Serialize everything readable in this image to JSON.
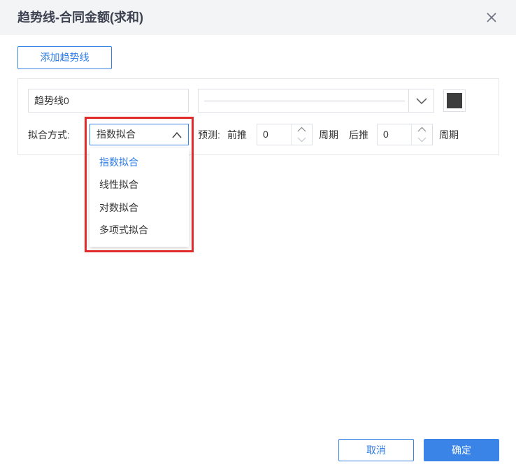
{
  "dialog": {
    "title": "趋势线-合同金额(求和)",
    "close_icon": "close-icon"
  },
  "toolbar": {
    "add_trendline_label": "添加趋势线"
  },
  "trendline": {
    "name_value": "趋势线0",
    "line_style_icon": "chevron-down-icon",
    "color": "#3d3d3d",
    "fit_method_label": "拟合方式:",
    "fit_method_selected": "指数拟合",
    "fit_method_icon": "chevron-up-icon",
    "forecast_label": "预测:",
    "forward_label": "前推",
    "forward_value": "0",
    "forward_unit": "周期",
    "backward_label": "后推",
    "backward_value": "0",
    "backward_unit": "周期"
  },
  "fit_dropdown": {
    "options": [
      "指数拟合",
      "线性拟合",
      "对数拟合",
      "多项式拟合"
    ],
    "selected_index": 0,
    "highlight_color": "#e22a2a"
  },
  "footer": {
    "cancel_label": "取消",
    "ok_label": "确定"
  },
  "colors": {
    "accent": "#3a84e8",
    "title_bar": "#f3f4f6"
  }
}
